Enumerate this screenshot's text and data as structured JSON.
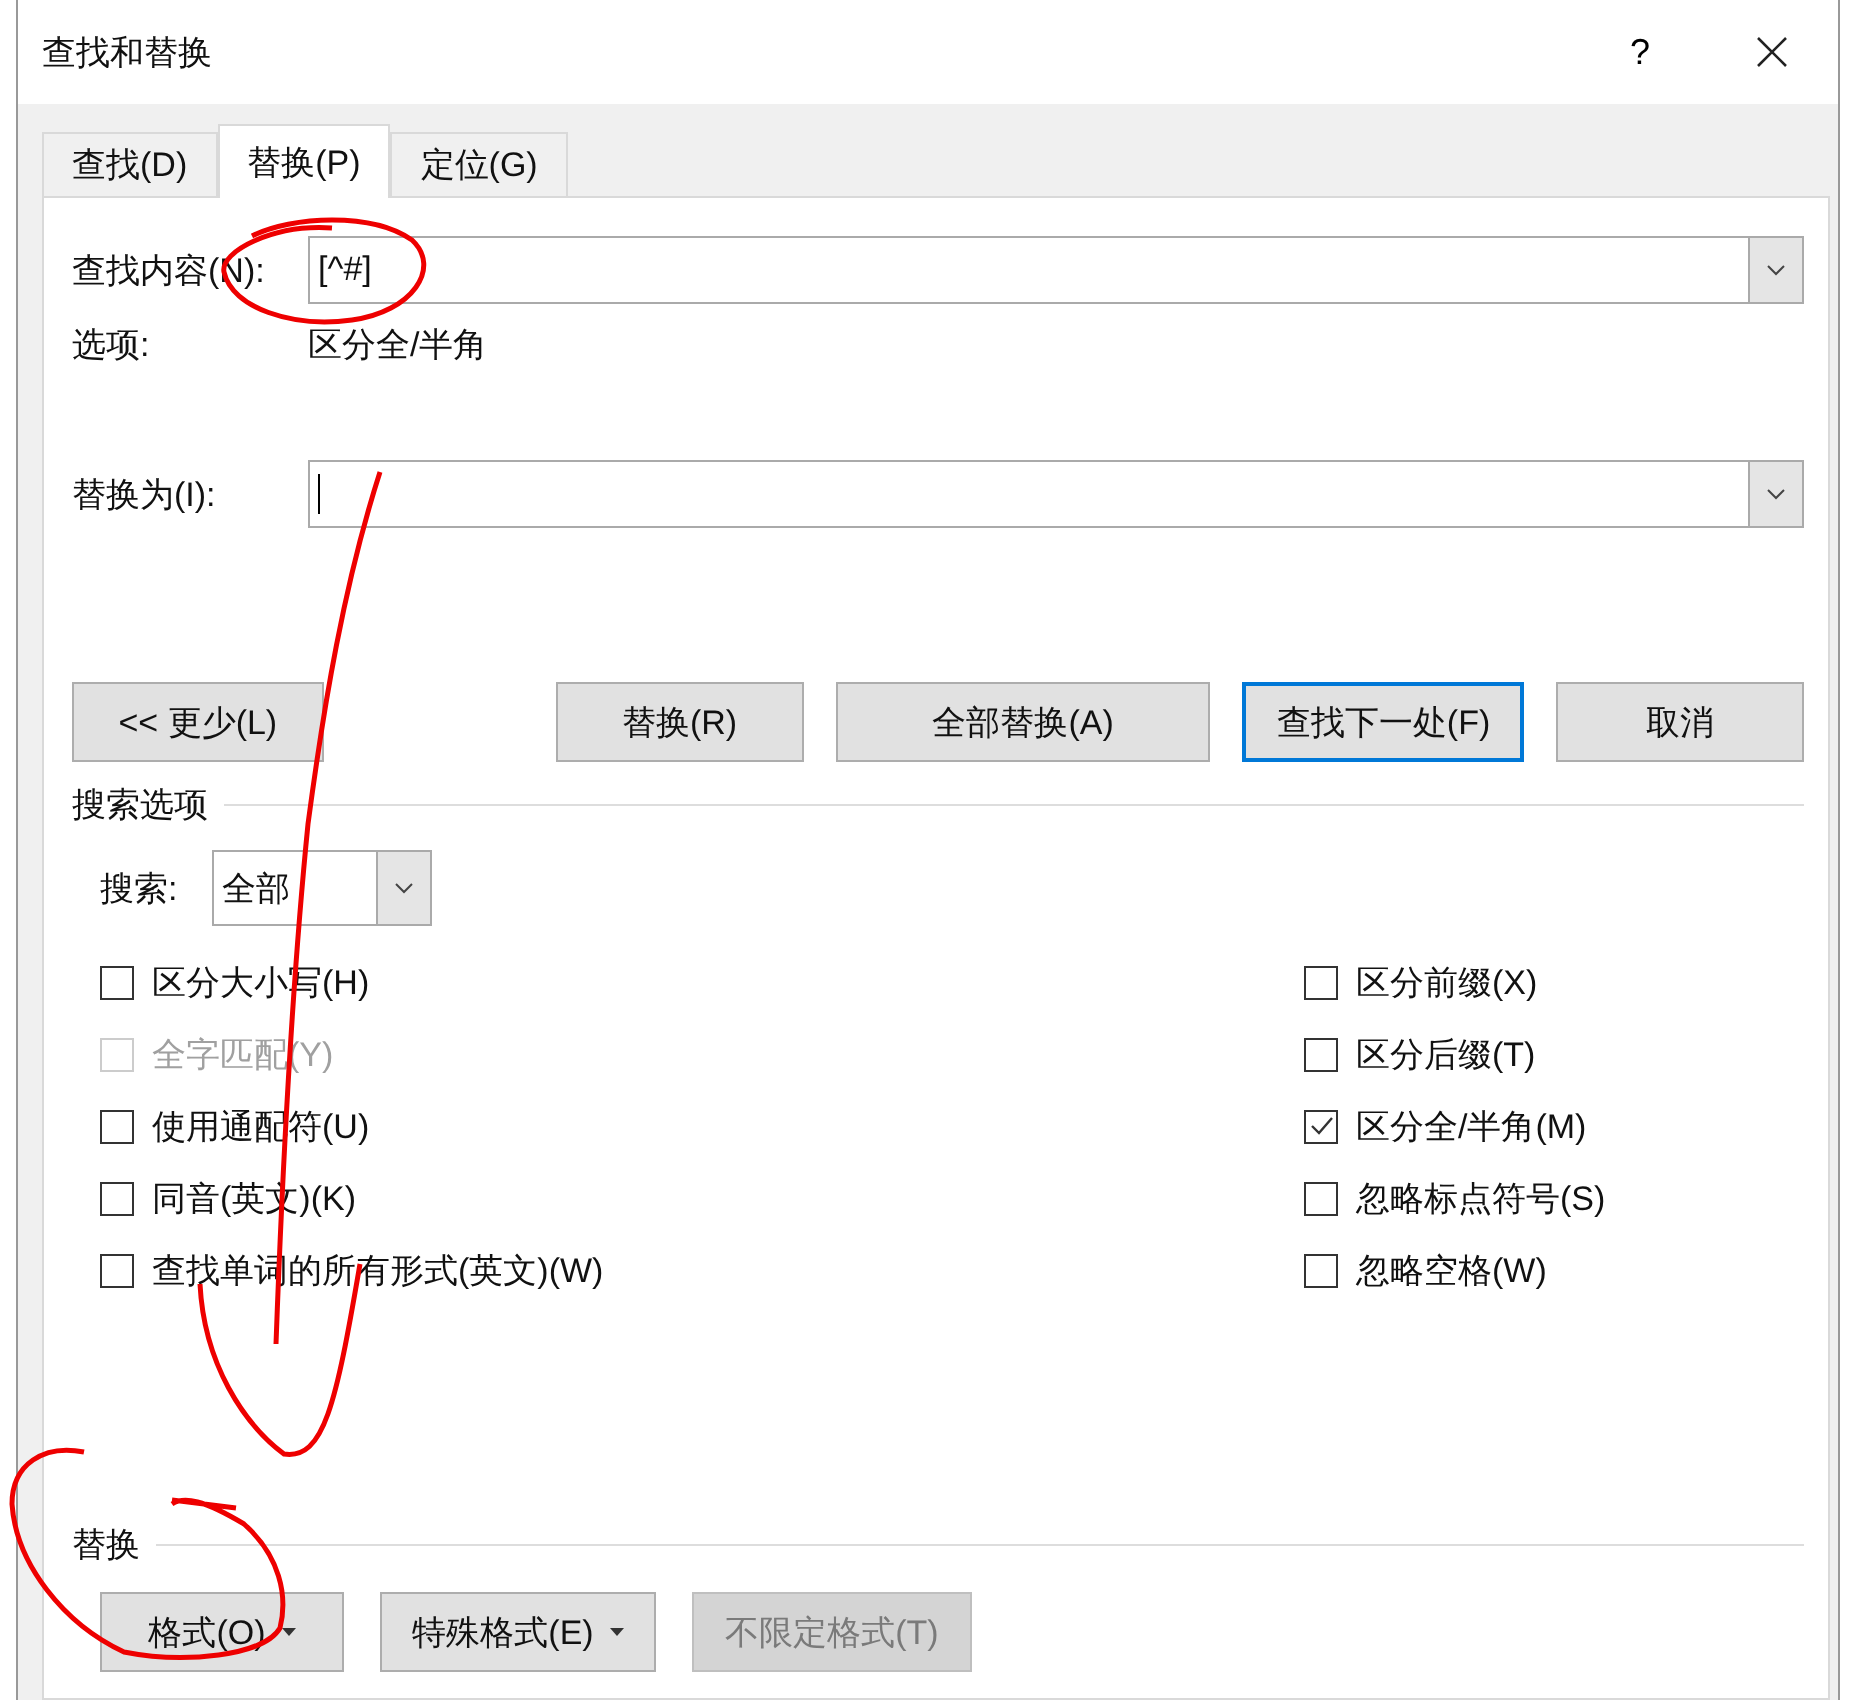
{
  "dialog": {
    "title": "查找和替换",
    "help": "?"
  },
  "tabs": [
    {
      "label": "查找(D)",
      "selected": false
    },
    {
      "label": "替换(P)",
      "selected": true
    },
    {
      "label": "定位(G)",
      "selected": false
    }
  ],
  "find": {
    "label": "查找内容(N):",
    "value": "[^#]"
  },
  "format_info": {
    "label": "选项:",
    "value": "区分全/半角"
  },
  "replace": {
    "label": "替换为(I):",
    "focused": true
  },
  "buttons": [
    {
      "label": "<< 更少(L)",
      "default": false
    },
    {
      "label": "替换(R)",
      "default": false
    },
    {
      "label": "全部替换(A)",
      "default": false
    },
    {
      "label": "查找下一处(F)",
      "default": true
    },
    {
      "label": "取消",
      "default": false
    }
  ],
  "search_options": {
    "title": "搜索选项",
    "search_label": "搜索:",
    "search_value": "全部",
    "left": [
      {
        "label": "区分大小写(H)",
        "checked": false,
        "disabled": false
      },
      {
        "label": "全字匹配(Y)",
        "checked": false,
        "disabled": true
      },
      {
        "label": "使用通配符(U)",
        "checked": false,
        "disabled": false
      },
      {
        "label": "同音(英文)(K)",
        "checked": false,
        "disabled": false
      },
      {
        "label": "查找单词的所有形式(英文)(W)",
        "checked": false,
        "disabled": false
      }
    ],
    "right": [
      {
        "label": "区分前缀(X)",
        "checked": false,
        "disabled": false
      },
      {
        "label": "区分后缀(T)",
        "checked": false,
        "disabled": false
      },
      {
        "label": "区分全/半角(M)",
        "checked": true,
        "disabled": false
      },
      {
        "label": "忽略标点符号(S)",
        "checked": false,
        "disabled": false
      },
      {
        "label": "忽略空格(W)",
        "checked": false,
        "disabled": false
      }
    ]
  },
  "replace_section": {
    "title": "替换",
    "buttons": [
      {
        "label": "格式(O)",
        "dropdown": true,
        "disabled": false
      },
      {
        "label": "特殊格式(E)",
        "dropdown": true,
        "disabled": false
      },
      {
        "label": "不限定格式(T)",
        "dropdown": false,
        "disabled": true
      }
    ]
  }
}
